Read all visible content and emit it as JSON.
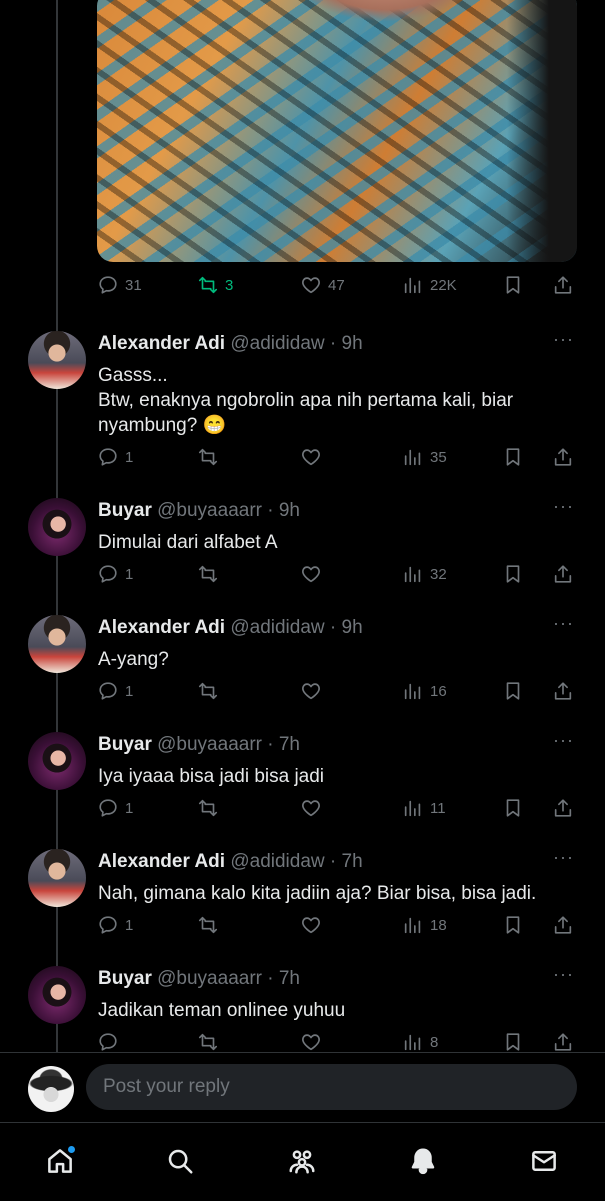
{
  "accent_color": "#1d9bf0",
  "retweet_active_color": "#00ba7c",
  "top_post": {
    "stats": {
      "replies": "31",
      "retweets": "3",
      "likes": "47",
      "views": "22K"
    }
  },
  "tweets": [
    {
      "name": "Alexander Adi",
      "handle": "@adididaw · 9h",
      "text": "Gasss...\nBtw, enaknya ngobrolin apa nih pertama kali, biar\nnyambung? 😁",
      "replies": "1",
      "views": "35"
    },
    {
      "name": "Buyar",
      "handle": "@buyaaaarr · 9h",
      "text": "Dimulai dari alfabet A",
      "replies": "1",
      "views": "32"
    },
    {
      "name": "Alexander Adi",
      "handle": "@adididaw · 9h",
      "text": "A-yang?",
      "replies": "1",
      "views": "16"
    },
    {
      "name": "Buyar",
      "handle": "@buyaaaarr · 7h",
      "text": "Iya iyaaa bisa jadi bisa jadi",
      "replies": "1",
      "views": "11"
    },
    {
      "name": "Alexander Adi",
      "handle": "@adididaw · 7h",
      "text": "Nah, gimana kalo kita jadiin aja? Biar bisa, bisa jadi.",
      "replies": "1",
      "views": "18"
    },
    {
      "name": "Buyar",
      "handle": "@buyaaaarr · 7h",
      "text": "Jadikan teman onlinee yuhuu",
      "replies": "",
      "views": "8"
    }
  ],
  "more_glyph": "···",
  "reply_box": {
    "placeholder": "Post your reply"
  },
  "nav": [
    "home-icon",
    "search-icon",
    "communities-icon",
    "notifications-icon",
    "messages-icon"
  ]
}
